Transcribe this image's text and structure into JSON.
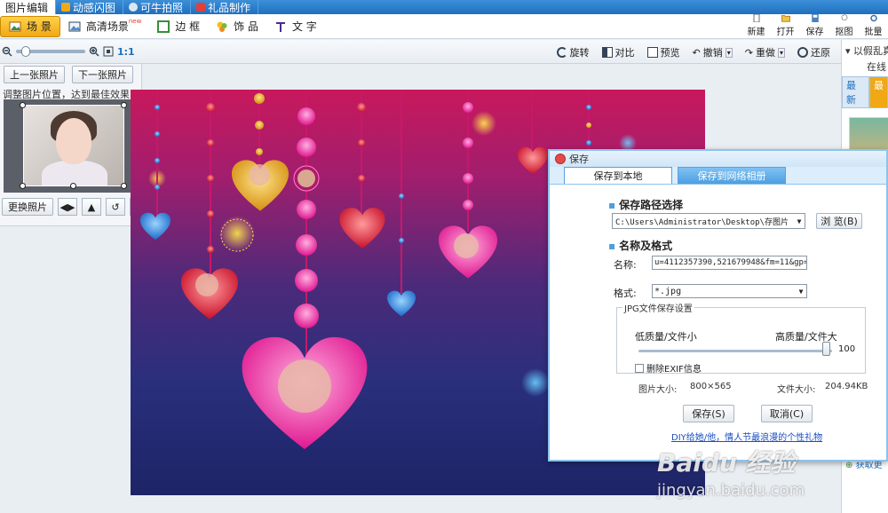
{
  "top_tabs": [
    {
      "label": "图片编辑",
      "active": true
    },
    {
      "label": "动感闪图",
      "active": false
    },
    {
      "label": "可牛拍照",
      "active": false
    },
    {
      "label": "礼品制作",
      "active": false
    }
  ],
  "toolbar": {
    "tools": [
      {
        "label": "场 景",
        "icon": "scene-icon",
        "active": true
      },
      {
        "label": "高清场景",
        "icon": "hd-scene-icon",
        "badge": "new",
        "active": false
      },
      {
        "label": "边 框",
        "icon": "border-icon",
        "active": false
      },
      {
        "label": "饰 品",
        "icon": "accessory-icon",
        "active": false
      },
      {
        "label": "文 字",
        "icon": "text-icon",
        "active": false
      }
    ],
    "right_buttons": [
      {
        "label": "新建",
        "icon": "new-file-icon"
      },
      {
        "label": "打开",
        "icon": "open-folder-icon"
      },
      {
        "label": "保存",
        "icon": "save-icon"
      },
      {
        "label": "抠图",
        "icon": "cutout-icon"
      },
      {
        "label": "批量",
        "icon": "batch-icon"
      }
    ]
  },
  "toolbar2": {
    "zoom_ratio": "1:1",
    "edit_buttons": [
      {
        "label": "旋转",
        "icon": "rotate-icon"
      },
      {
        "label": "对比",
        "icon": "compare-icon"
      },
      {
        "label": "预览",
        "icon": "preview-icon"
      },
      {
        "label": "撤销",
        "icon": "undo-icon"
      },
      {
        "label": "重做",
        "icon": "redo-icon"
      },
      {
        "label": "还原",
        "icon": "restore-icon"
      }
    ]
  },
  "left_panel": {
    "prev_label": "上一张照片",
    "next_label": "下一张照片",
    "hint": "调整图片位置，达到最佳效果",
    "replace_label": "更换照片"
  },
  "right_panel": {
    "title": "以假乱真",
    "sub": "在线",
    "tabs": [
      "最新",
      "最"
    ],
    "bottom_link": "获取更"
  },
  "dialog": {
    "title": "保存",
    "tabs": [
      "保存到本地",
      "保存到网络相册"
    ],
    "path_section": "保存路径选择",
    "path_value": "C:\\Users\\Administrator\\Desktop\\存图片",
    "browse_label": "浏 览(B)",
    "name_section": "名称及格式",
    "name_label": "名称:",
    "name_value": "u=4112357390,521679948&fm=11&gp=0_c",
    "format_label": "格式:",
    "format_value": "*.jpg",
    "jpg_settings_label": "JPG文件保存设置",
    "quality_low": "低质量/文件小",
    "quality_high": "高质量/文件大",
    "quality_value": "100",
    "quality_fraction": 0.97,
    "exif_label": "删除EXIF信息",
    "exif_checked": false,
    "image_size_label": "图片大小:",
    "image_size_value": "800×565",
    "file_size_label": "文件大小:",
    "file_size_value": "204.94KB",
    "save_button": "保存(S)",
    "cancel_button": "取消(C)",
    "link_text": "DIY给她/他，情人节最浪漫的个性礼物"
  },
  "watermark": {
    "line1": "Baidu 经验",
    "line2": "jingyan.baidu.com"
  },
  "colors": {
    "tabbar": "#1f6fbf",
    "accent_active": "#f0a815",
    "dialog_border": "#8cc3ee",
    "link": "#1a4fc4"
  }
}
